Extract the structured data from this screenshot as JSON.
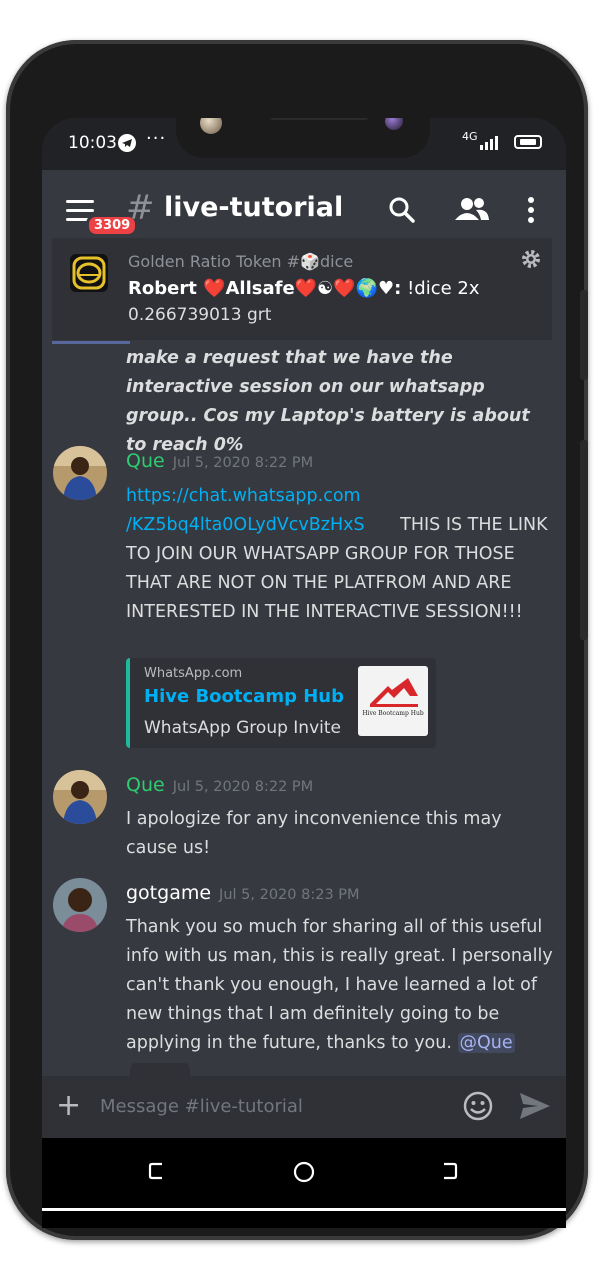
{
  "status_bar": {
    "time": "10:03",
    "dots": "···",
    "network": "4G"
  },
  "header": {
    "unread_badge": "3309",
    "channel_hash": "#",
    "channel_name": "live-tutorial"
  },
  "pinned": {
    "source": "Golden Ratio Token #🎲dice",
    "user": "Robert ❤️Allsafe❤️☯❤️🌍♥:",
    "command": " !dice 2x",
    "amount": "0.266739013 grt"
  },
  "messages": {
    "continuation_text": "make a request that we have the interactive session on our whatsapp group.. Cos my Laptop's battery is about to reach 0%",
    "m1": {
      "author": "Que",
      "author_color": "#2ecc71",
      "timestamp": "Jul 5, 2020 8:22 PM",
      "link_line1": "https://chat.whatsapp.com",
      "link_line2": "/KZ5bq4lta0OLydVcvBzHxS",
      "text_after_link": "THIS IS THE LINK TO JOIN OUR WHATSAPP GROUP FOR THOSE THAT ARE NOT ON THE PLATFROM AND ARE INTERESTED IN THE INTERACTIVE SESSION!!!",
      "embed": {
        "provider": "WhatsApp.com",
        "title": "Hive Bootcamp Hub",
        "description": "WhatsApp Group Invite",
        "thumb_caption": "Hive Bootcamp Hub"
      }
    },
    "m2": {
      "author": "Que",
      "timestamp": "Jul 5, 2020 8:22 PM",
      "text": "I apologize for any inconvenience this may cause us!"
    },
    "m3": {
      "author": "gotgame",
      "author_color": "#ffffff",
      "timestamp": "Jul 5, 2020 8:23 PM",
      "text": "Thank you so much for sharing all of this useful info with us man, this is really great. I personally can't thank you enough, I have learned a lot of new things that I am definitely going to be applying in the future, thanks to you.",
      "mention": "@Que"
    }
  },
  "composer": {
    "plus": "+",
    "placeholder": "Message #live-tutorial"
  },
  "colors": {
    "background": "#36393f",
    "accent": "#7289da",
    "link": "#00b0f4",
    "embed_bar": "#1dba9d"
  }
}
